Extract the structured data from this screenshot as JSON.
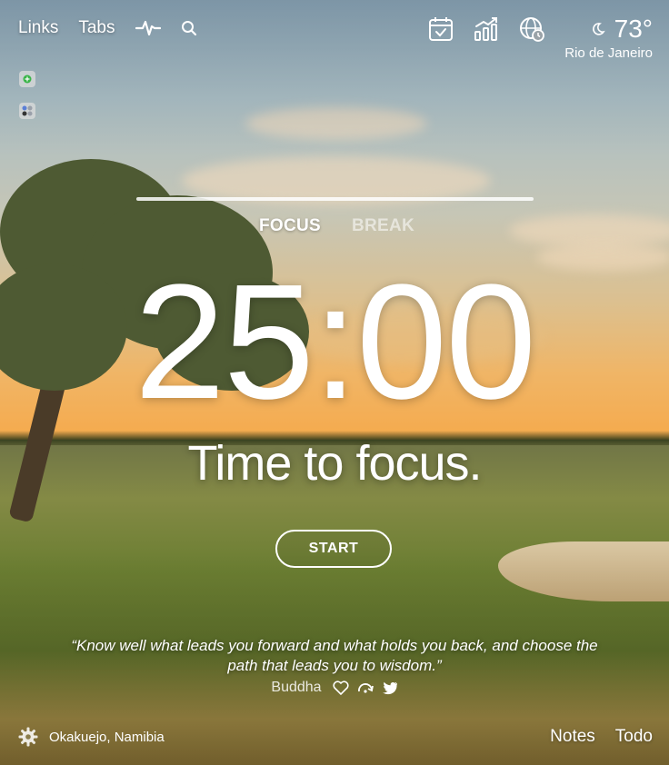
{
  "nav": {
    "links_label": "Links",
    "tabs_label": "Tabs",
    "icons": [
      "pulse-icon",
      "search-icon"
    ]
  },
  "apps": [
    "app-tile-1",
    "app-tile-2"
  ],
  "top_right": {
    "icons": [
      "calendar-icon",
      "stats-icon",
      "globe-clock-icon"
    ],
    "weather": {
      "icon": "moon-icon",
      "temperature": "73°",
      "location": "Rio de Janeiro"
    }
  },
  "timer": {
    "modes": [
      {
        "label": "FOCUS",
        "active": true
      },
      {
        "label": "BREAK",
        "active": false
      }
    ],
    "time": "25:00",
    "message": "Time to focus.",
    "start_label": "START"
  },
  "quote": {
    "text": "“Know well what leads you forward and what holds you back, and choose the path that leads you to wisdom.”",
    "author": "Buddha",
    "icons": [
      "heart-icon",
      "skip-icon",
      "twitter-icon"
    ]
  },
  "footer": {
    "settings_icon": "gear-icon",
    "photo_location": "Okakuejo, Namibia",
    "notes_label": "Notes",
    "todo_label": "Todo"
  }
}
